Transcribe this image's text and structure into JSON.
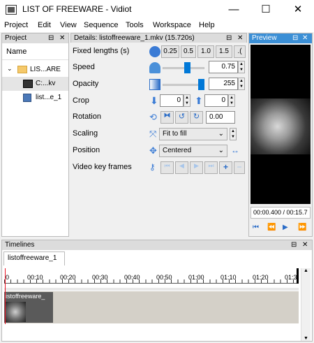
{
  "window": {
    "title": "LIST OF FREEWARE - Vidiot",
    "min": "—",
    "max": "☐",
    "close": "✕"
  },
  "menu": [
    "Project",
    "Edit",
    "View",
    "Sequence",
    "Tools",
    "Workspace",
    "Help"
  ],
  "project": {
    "header": "Project",
    "column": "Name",
    "folder": "LIS...ARE",
    "items": [
      "C:...kv",
      "list...e_1"
    ]
  },
  "details": {
    "header": "Details: listoffreeware_1.mkv (15.720s)",
    "rows": {
      "fixed_lengths": {
        "label": "Fixed lengths (s)",
        "buttons": [
          "0.25",
          "0.5",
          "1.0",
          "1.5",
          ".("
        ]
      },
      "speed": {
        "label": "Speed",
        "value": "0.75",
        "level": 0.6
      },
      "opacity": {
        "label": "Opacity",
        "value": "255",
        "level": 1.0
      },
      "crop": {
        "label": "Crop",
        "left": "0",
        "top": "0"
      },
      "rotation": {
        "label": "Rotation",
        "value": "0.00"
      },
      "scaling": {
        "label": "Scaling",
        "value": "Fit to fill"
      },
      "position": {
        "label": "Position",
        "value": "Centered"
      },
      "keyframes": {
        "label": "Video key frames"
      }
    }
  },
  "preview": {
    "header": "Preview",
    "time": "00:00.400 / 00:15.7"
  },
  "timelines": {
    "header": "Timelines",
    "tab": "listoffreeware_1",
    "ticks": [
      "0",
      "00:10",
      "00:20",
      "00:30",
      "00:40",
      "00:50",
      "01:00",
      "01:10",
      "01:20",
      "01:3"
    ],
    "clip_label": "istoffreeware_"
  },
  "colors": {
    "active_header": "#3b8fd6",
    "accent": "#0078d7",
    "playhead": "#e81123"
  }
}
